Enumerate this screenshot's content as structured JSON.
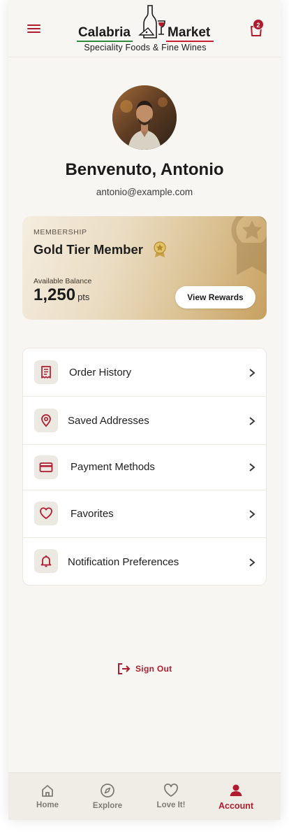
{
  "header": {
    "brand_left": "Calabria",
    "brand_right": "Market",
    "tagline": "Speciality Foods & Fine Wines",
    "cart_count": "2",
    "menu_icon": "hamburger-icon",
    "cart_icon": "shopping-bag-icon"
  },
  "profile": {
    "welcome": "Benvenuto, Antonio",
    "email": "antonio@example.com"
  },
  "membership": {
    "kicker": "MEMBERSHIP",
    "tier": "Gold Tier Member",
    "balance_label": "Available Balance",
    "balance": "1,250",
    "balance_unit": "pts",
    "button": "View Rewards"
  },
  "menu": {
    "items": [
      {
        "label": "Order History",
        "icon": "receipt-icon"
      },
      {
        "label": "Saved Addresses",
        "icon": "map-pin-icon"
      },
      {
        "label": "Payment Methods",
        "icon": "credit-card-icon"
      },
      {
        "label": "Favorites",
        "icon": "heart-icon"
      },
      {
        "label": "Notification Preferences",
        "icon": "bell-icon"
      }
    ]
  },
  "signout": {
    "label": "Sign Out"
  },
  "tabs": [
    {
      "label": "Home",
      "icon": "home-icon"
    },
    {
      "label": "Explore",
      "icon": "compass-icon"
    },
    {
      "label": "Love It!",
      "icon": "heart-icon"
    },
    {
      "label": "Account",
      "icon": "user-icon",
      "active": true
    }
  ],
  "colors": {
    "accent": "#b01c2e",
    "gold": "#c7a05f",
    "background": "#f8f6f2"
  }
}
